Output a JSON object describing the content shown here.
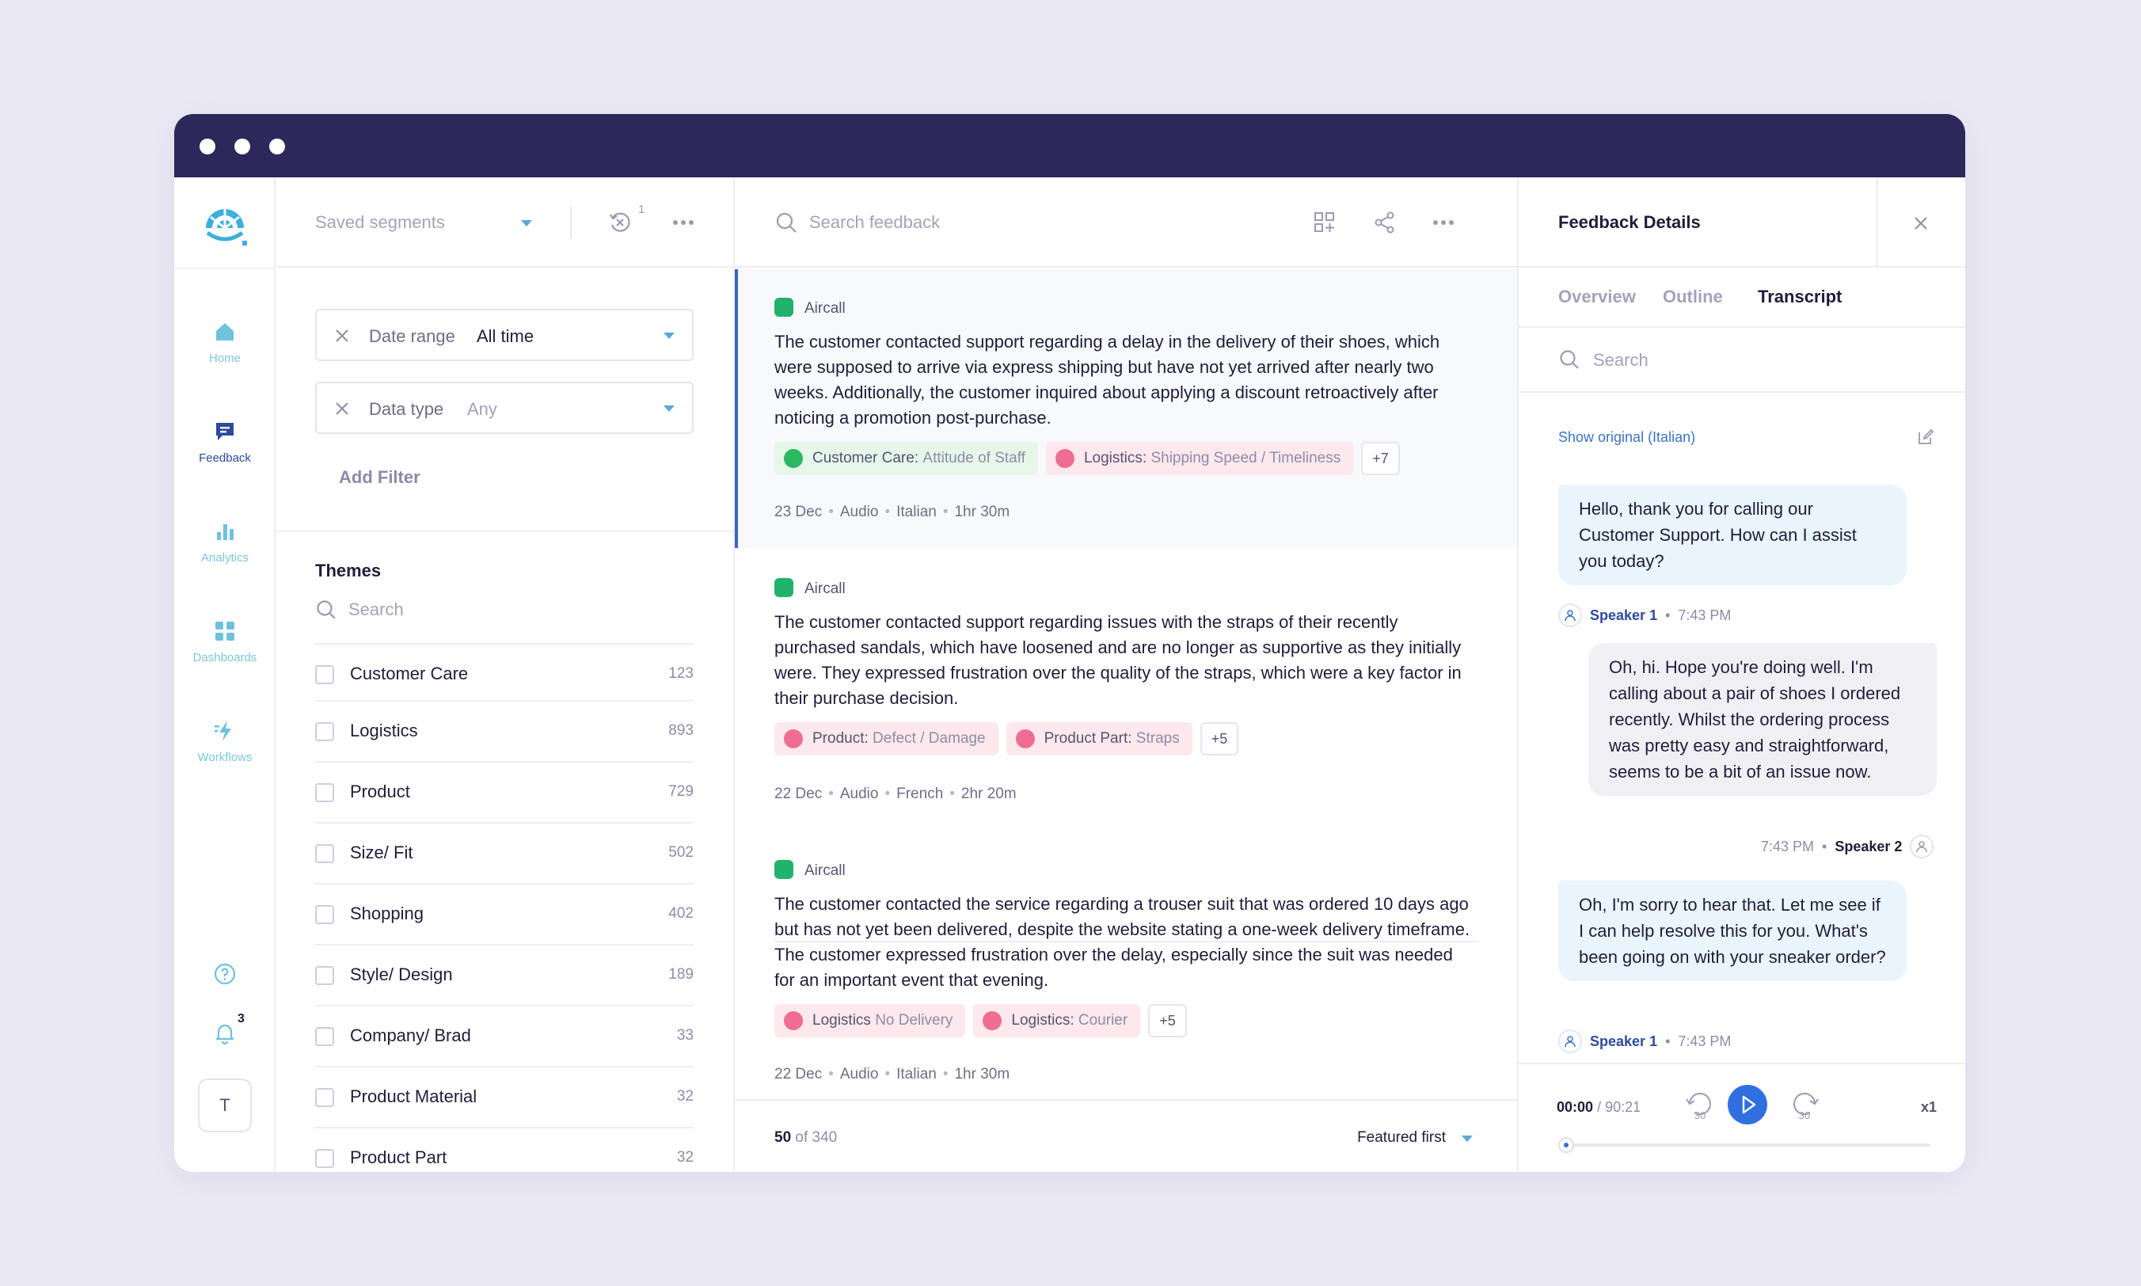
{
  "colors": {
    "titlebar": "#2e2759",
    "accent": "#2f6fe0",
    "nav_icon": "#6fc2db",
    "positive": "#2bb860",
    "negative": "#f06d92"
  },
  "nav": {
    "items": [
      {
        "label": "Home",
        "icon": "home-icon"
      },
      {
        "label": "Feedback",
        "icon": "feedback-icon",
        "active": true
      },
      {
        "label": "Analytics",
        "icon": "analytics-icon"
      },
      {
        "label": "Dashboards",
        "icon": "dashboards-icon"
      },
      {
        "label": "Workflows",
        "icon": "workflows-icon"
      }
    ],
    "notification_count": "3",
    "avatar_initial": "T"
  },
  "filters": {
    "saved_segments": "Saved segments",
    "filter_badge": "1",
    "date_range": {
      "name": "Date range",
      "value": "All time"
    },
    "data_type": {
      "name": "Data type",
      "value": "Any"
    },
    "add_filter": "Add Filter"
  },
  "themes": {
    "title": "Themes",
    "search_placeholder": "Search",
    "items": [
      {
        "name": "Customer Care",
        "count": "123"
      },
      {
        "name": "Logistics",
        "count": "893"
      },
      {
        "name": "Product",
        "count": "729"
      },
      {
        "name": "Size/ Fit",
        "count": "502"
      },
      {
        "name": "Shopping",
        "count": "402"
      },
      {
        "name": "Style/ Design",
        "count": "189"
      },
      {
        "name": "Company/ Brad",
        "count": "33"
      },
      {
        "name": "Product Material",
        "count": "32"
      },
      {
        "name": "Product Part",
        "count": "32"
      }
    ]
  },
  "feed": {
    "search_placeholder": "Search feedback",
    "cards": [
      {
        "source": "Aircall",
        "text": "The customer contacted support regarding a delay in the delivery of their shoes, which were supposed to arrive via express shipping but have not yet arrived after nearly two weeks. Additionally, the customer inquired about applying a discount retroactively after noticing a promotion post-purchase.",
        "tags": [
          {
            "category": "Customer Care:",
            "sub": "Attitude of Staff",
            "sentiment": "positive"
          },
          {
            "category": "Logistics:",
            "sub": "Shipping Speed / Timeliness",
            "sentiment": "negative"
          }
        ],
        "more": "+7",
        "meta": {
          "date": "23 Dec",
          "type": "Audio",
          "language": "Italian",
          "duration": "1hr 30m"
        }
      },
      {
        "source": "Aircall",
        "text": "The customer contacted support regarding issues with the straps of their recently purchased sandals, which have loosened and are no longer as supportive as they initially were. They expressed frustration over the quality of the straps, which were a key factor in their purchase decision.",
        "tags": [
          {
            "category": "Product:",
            "sub": "Defect / Damage",
            "sentiment": "negative"
          },
          {
            "category": "Product Part:",
            "sub": "Straps",
            "sentiment": "negative"
          }
        ],
        "more": "+5",
        "meta": {
          "date": "22 Dec",
          "type": "Audio",
          "language": "French",
          "duration": "2hr 20m"
        }
      },
      {
        "source": "Aircall",
        "text": "The customer contacted the service regarding a trouser suit that was ordered 10 days ago but has not yet been delivered, despite the website stating a one-week delivery timeframe. The customer expressed frustration over the delay, especially since the suit was needed for an important event that evening.",
        "tags": [
          {
            "category": "Logistics",
            "sub": "No Delivery",
            "sentiment": "negative"
          },
          {
            "category": "Logistics:",
            "sub": "Courier",
            "sentiment": "negative"
          }
        ],
        "more": "+5",
        "meta": {
          "date": "22 Dec",
          "type": "Audio",
          "language": "Italian",
          "duration": "1hr 30m"
        }
      }
    ],
    "footer": {
      "shown": "50",
      "total": "of 340",
      "sort": "Featured first"
    }
  },
  "details": {
    "title": "Feedback Details",
    "tabs": [
      "Overview",
      "Outline",
      "Transcript"
    ],
    "active_tab": "Transcript",
    "search_placeholder": "Search",
    "show_original": "Show original (Italian)",
    "messages": [
      {
        "text": "Hello, thank you for calling our Customer Support. How can I assist you today?",
        "speaker": "Speaker 1",
        "time": "7:43 PM",
        "side": "left"
      },
      {
        "text": "Oh, hi. Hope you're doing well. I'm calling about a pair of shoes I ordered recently. Whilst the ordering process was pretty easy and straightforward, seems to be a bit of an issue now.",
        "speaker": "Speaker 2",
        "time": "7:43 PM",
        "side": "right"
      },
      {
        "text": "Oh, I'm sorry to hear that. Let me see if I can help resolve this for you. What's been going on with your sneaker order?",
        "speaker": "Speaker 1",
        "time": "7:43 PM",
        "side": "left"
      }
    ],
    "player": {
      "current": "00:00",
      "total": "/ 90:21",
      "skip_back": "30",
      "skip_forward": "30",
      "speed": "x1",
      "progress": 0
    }
  }
}
